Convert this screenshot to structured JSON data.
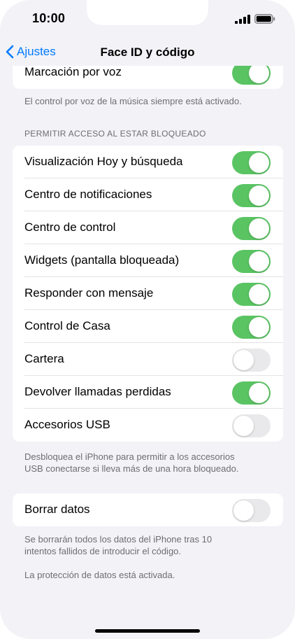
{
  "status_bar": {
    "time": "10:00"
  },
  "nav": {
    "back_label": "Ajustes",
    "title": "Face ID y código"
  },
  "partial_group": {
    "label": "Marcación por voz",
    "toggle_on": true,
    "footnote": "El control por voz de la música siempre está activado."
  },
  "locked_access": {
    "header": "PERMITIR ACCESO AL ESTAR BLOQUEADO",
    "items": [
      {
        "label": "Visualización Hoy y búsqueda",
        "on": true
      },
      {
        "label": "Centro de notificaciones",
        "on": true
      },
      {
        "label": "Centro de control",
        "on": true
      },
      {
        "label": "Widgets (pantalla bloqueada)",
        "on": true
      },
      {
        "label": "Responder con mensaje",
        "on": true
      },
      {
        "label": "Control de Casa",
        "on": true
      },
      {
        "label": "Cartera",
        "on": false
      },
      {
        "label": "Devolver llamadas perdidas",
        "on": true
      },
      {
        "label": "Accesorios USB",
        "on": false
      }
    ],
    "footnote_line1": "Desbloquea el iPhone para permitir a los accesorios",
    "footnote_line2": "USB conectarse si lleva más de una hora bloqueado."
  },
  "erase": {
    "label": "Borrar datos",
    "on": false,
    "footnote_line1": "Se borrarán todos los datos del iPhone tras 10",
    "footnote_line2": "intentos fallidos de introducir el código.",
    "protection_note": "La protección de datos está activada."
  },
  "colors": {
    "accent": "#007aff",
    "toggle_on": "#5ac463",
    "toggle_off": "#e9e9eb",
    "background": "#f2f2f7"
  }
}
